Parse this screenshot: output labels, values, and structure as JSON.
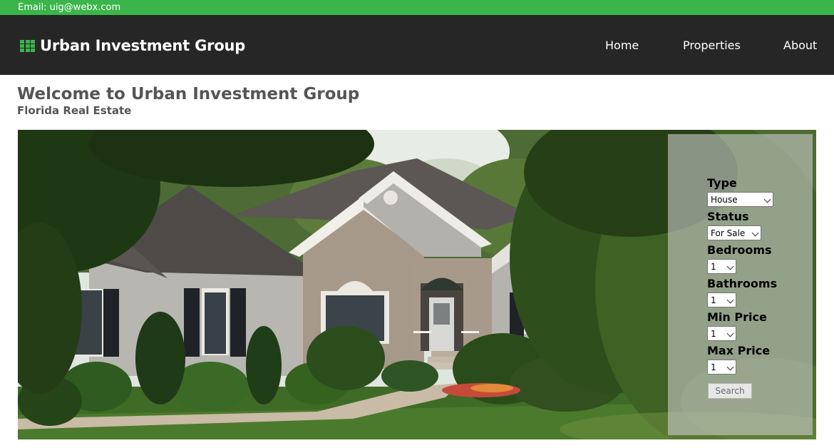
{
  "topbar": {
    "email": "Email: uig@webx.com"
  },
  "brand": {
    "name": "Urban Investment Group",
    "icon": "grid-icon",
    "accent": "#3bb54a"
  },
  "nav": {
    "items": [
      {
        "label": "Home"
      },
      {
        "label": "Properties"
      },
      {
        "label": "About"
      }
    ]
  },
  "page": {
    "title": "Welcome to Urban Investment Group",
    "subtitle": "Florida Real Estate"
  },
  "search": {
    "fields": [
      {
        "label": "Type",
        "value": "House"
      },
      {
        "label": "Status",
        "value": "For Sale"
      },
      {
        "label": "Bedrooms",
        "value": "1"
      },
      {
        "label": "Bathrooms",
        "value": "1"
      },
      {
        "label": "Min Price",
        "value": "1"
      },
      {
        "label": "Max Price",
        "value": "1"
      }
    ],
    "button_label": "Search"
  }
}
